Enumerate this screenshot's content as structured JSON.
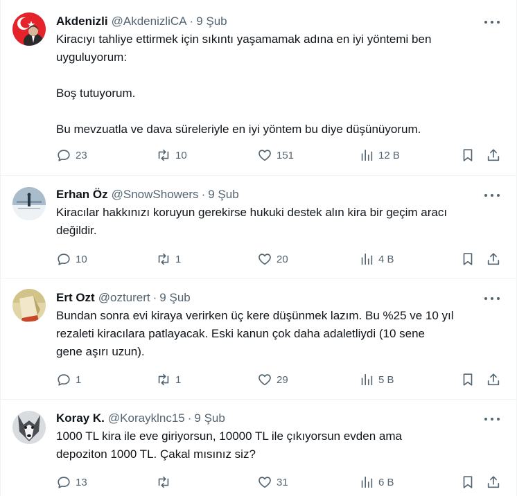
{
  "tweets": [
    {
      "name": "Akdenizli",
      "handle": "@AkdenizliCA",
      "date": "9 Şub",
      "text": [
        "Kiracıyı tahliye ettirmek için sıkıntı yaşamamak adına en iyi yöntemi ben",
        "uyguluyorum:",
        "",
        "Boş tutuyorum.",
        "",
        "Bu mevzuatla ve dava süreleriyle en iyi yöntem bu diye düşünüyorum."
      ],
      "replies": "23",
      "retweets": "10",
      "likes": "151",
      "views": "12 B",
      "avatar_colors": [
        "#e4232b",
        "#ffffff"
      ]
    },
    {
      "name": "Erhan Öz",
      "handle": "@SnowShowers",
      "date": "9 Şub",
      "text": [
        "Kiracılar hakkınızı koruyun gerekirse hukuki destek alın kira bir geçim aracı",
        "değildir."
      ],
      "replies": "10",
      "retweets": "1",
      "likes": "20",
      "views": "4 B",
      "avatar_colors": [
        "#9fb3c3",
        "#e8edf0"
      ]
    },
    {
      "name": "Ert Ozt",
      "handle": "@ozturert",
      "date": "9 Şub",
      "text": [
        "Bundan sonra evi kiraya verirken üç kere düşünmek lazım. Bu %25 ve 10 yıl",
        "rezaleti kiracılara patlayacak. Eski kanun çok daha adaletliydi (10 sene",
        "gene aşırı uzun)."
      ],
      "replies": "1",
      "retweets": "1",
      "likes": "29",
      "views": "5 B",
      "avatar_colors": [
        "#d8c58d",
        "#c84a2b"
      ]
    },
    {
      "name": "Koray K.",
      "handle": "@Korayklnc15",
      "date": "9 Şub",
      "text": [
        "1000 TL kira ile eve giriyorsun, 10000 TL ile çıkıyorsun evden ama",
        "depoziton 1000 TL. Çakal mısınız siz?"
      ],
      "replies": "13",
      "retweets": "",
      "likes": "31",
      "views": "6 B",
      "avatar_colors": [
        "#6b7075",
        "#f1f1f1"
      ]
    }
  ],
  "separator": "·"
}
